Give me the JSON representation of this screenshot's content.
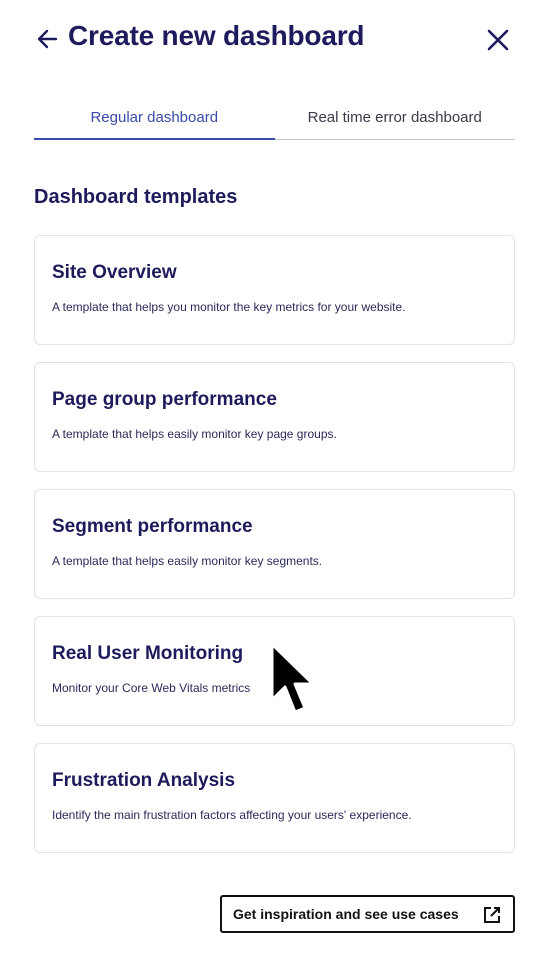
{
  "header": {
    "title": "Create new dashboard"
  },
  "icons": {
    "back": "arrow-left-icon",
    "close": "close-icon",
    "external": "external-link-icon",
    "cursor": "mouse-pointer"
  },
  "tabs": [
    {
      "label": "Regular dashboard",
      "active": true
    },
    {
      "label": "Real time error dashboard",
      "active": false
    }
  ],
  "section": {
    "title": "Dashboard templates"
  },
  "templates": [
    {
      "title": "Site Overview",
      "description": "A template that helps you monitor the key metrics for your website."
    },
    {
      "title": "Page group performance",
      "description": "A template that helps easily monitor key page groups."
    },
    {
      "title": "Segment performance",
      "description": "A template that helps easily monitor key segments."
    },
    {
      "title": "Real User Monitoring",
      "description": "Monitor your Core Web Vitals metrics"
    },
    {
      "title": "Frustration Analysis",
      "description": "Identify the main frustration factors affecting your users' experience."
    }
  ],
  "footer": {
    "inspiration_label": "Get inspiration and see use cases"
  },
  "colors": {
    "heading": "#1e1b5c",
    "accent": "#3a4aa6",
    "border": "#e3e3e8"
  }
}
